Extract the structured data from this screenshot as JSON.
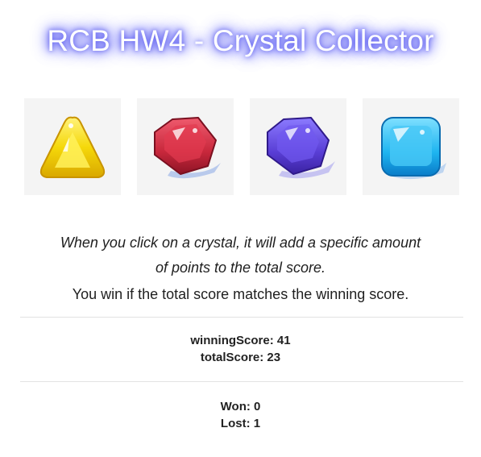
{
  "title": "RCB HW4 - Crystal Collector",
  "crystals": [
    {
      "name": "yellow-crystal",
      "color": "#f2d60a"
    },
    {
      "name": "red-crystal",
      "color": "#c8283c"
    },
    {
      "name": "purple-crystal",
      "color": "#5a3fd6"
    },
    {
      "name": "blue-crystal",
      "color": "#1eb4f0"
    }
  ],
  "instructions": {
    "line1": "When you click on a crystal, it will add a specific amount",
    "line2": "of points to the total score.",
    "line3": "You win if the total score matches the winning score."
  },
  "scores": {
    "winning": "winningScore: 41",
    "total": "totalScore: 23"
  },
  "record": {
    "won": "Won: 0",
    "lost": "Lost: 1"
  },
  "colors": {
    "title_glow": "#5b5cf0",
    "tile_background": "#f4f4f4"
  }
}
